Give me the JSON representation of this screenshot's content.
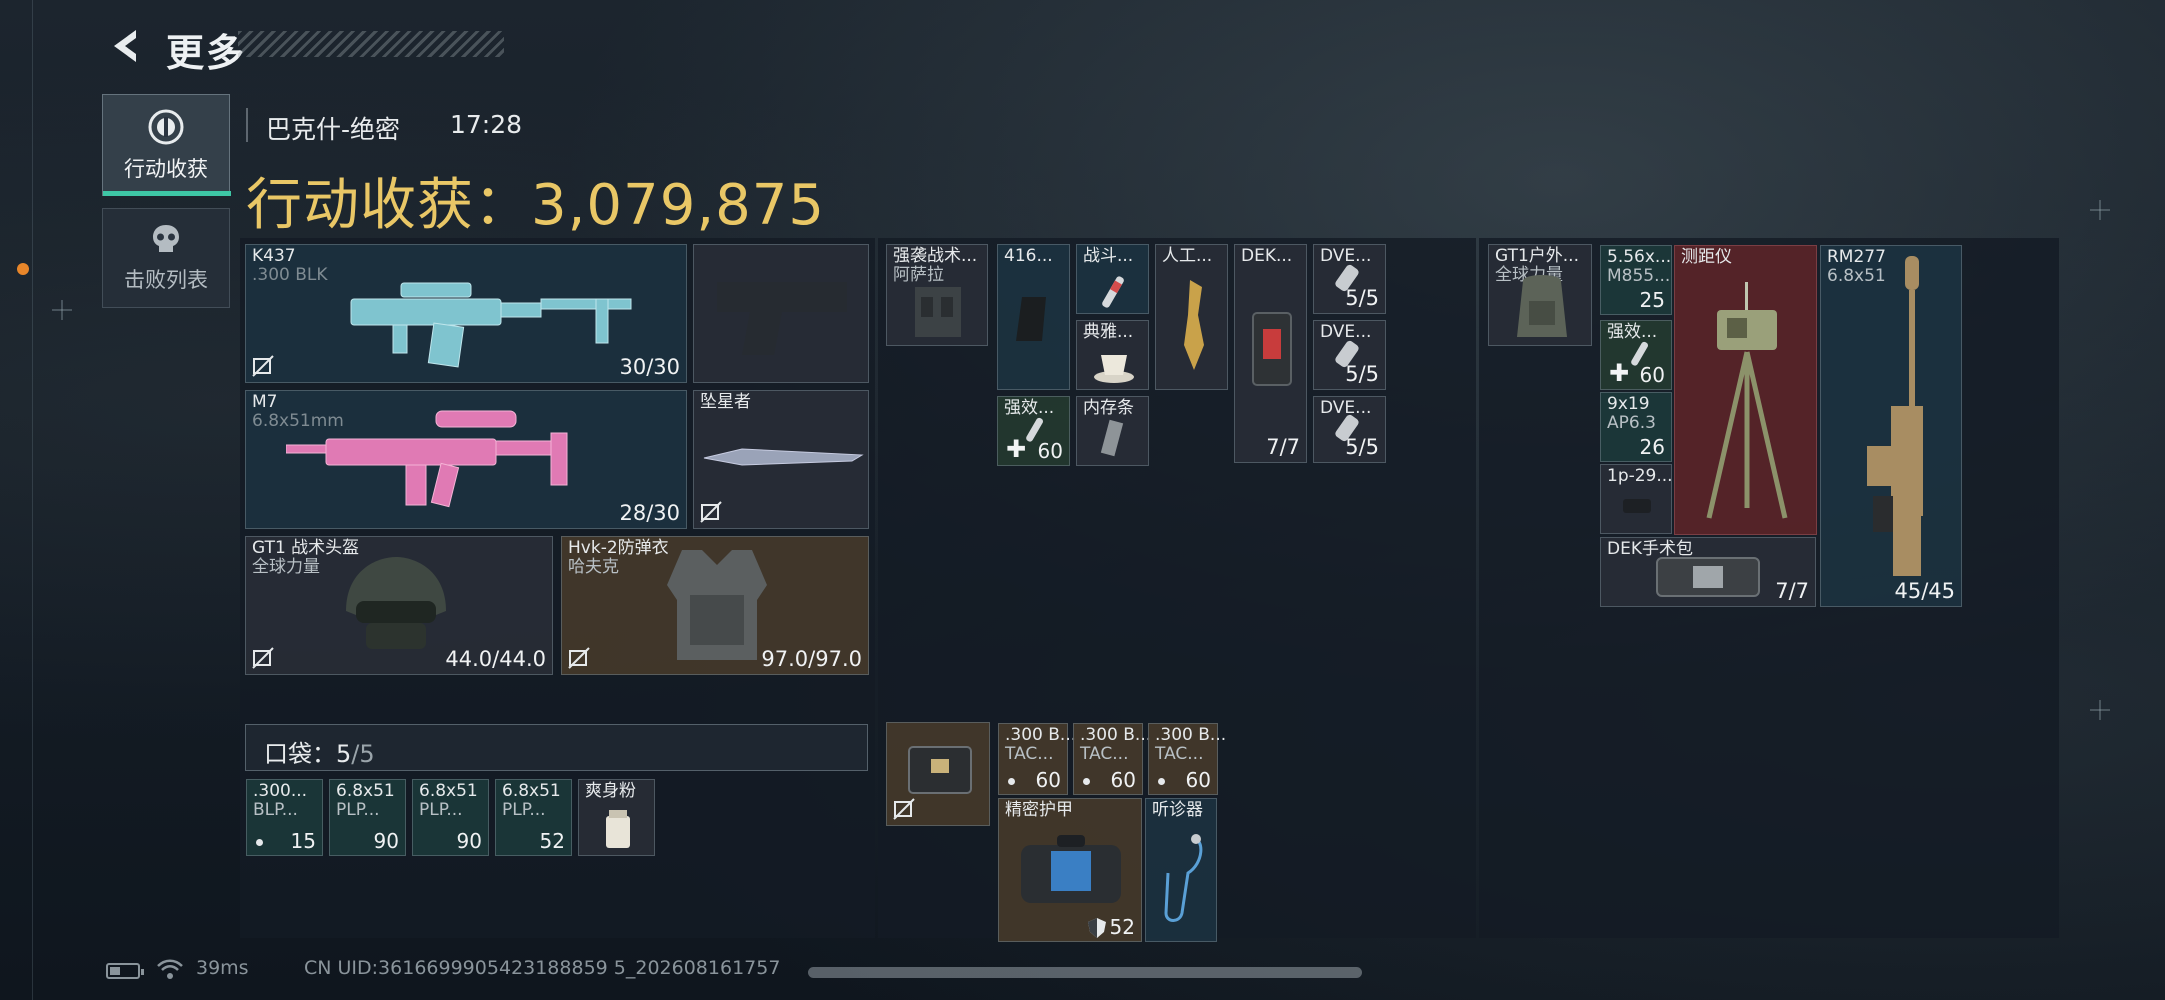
{
  "header": {
    "back_icon": "chevron-left-icon",
    "title": "更多"
  },
  "tabs": [
    {
      "label": "行动收获",
      "icon": "target-icon",
      "active": true
    },
    {
      "label": "击败列表",
      "icon": "skull-icon",
      "active": false
    }
  ],
  "mission": {
    "map": "巴克什-绝密",
    "time": "17:28",
    "haul": "行动收获：3,079,875"
  },
  "loadout": {
    "primary": {
      "name": "K437",
      "ammo_type": ".300 BLK",
      "ammo": "30/30"
    },
    "sidearm": {
      "name": "",
      "ammo": ""
    },
    "secondary": {
      "name": "M7",
      "ammo_type": "6.8x51mm",
      "ammo": "28/30"
    },
    "melee": {
      "name": "坠星者"
    },
    "helmet": {
      "name": "GT1 战术头盔",
      "brand": "全球力量",
      "durability": "44.0/44.0"
    },
    "armor": {
      "name": "Hvk-2防弹衣",
      "brand": "哈夫克",
      "durability": "97.0/97.0"
    }
  },
  "pocket": {
    "label_prefix": "口袋：",
    "used": "5",
    "slash_total": "/5",
    "items": [
      {
        "name": ".300...",
        "sub": "BLP...",
        "count": "15"
      },
      {
        "name": "6.8x51",
        "sub": "PLP...",
        "count": "90"
      },
      {
        "name": "6.8x51",
        "sub": "PLP...",
        "count": "90"
      },
      {
        "name": "6.8x51",
        "sub": "PLP...",
        "count": "52"
      },
      {
        "name": "爽身粉",
        "sub": "",
        "count": ""
      }
    ]
  },
  "rig": {
    "name": "强袭战术...",
    "brand": "阿萨拉",
    "items": [
      {
        "name": "416...",
        "count": ""
      },
      {
        "name": "战斗...",
        "count": ""
      },
      {
        "name": "人工...",
        "count": ""
      },
      {
        "name": "DEK...",
        "count": "7/7"
      },
      {
        "name": "DVE...",
        "count": "5/5"
      },
      {
        "name": "典雅...",
        "count": ""
      },
      {
        "name": "DVE...",
        "count": "5/5"
      },
      {
        "name": "强效...",
        "count": "60"
      },
      {
        "name": "内存条",
        "count": ""
      },
      {
        "name": "DVE...",
        "count": "5/5"
      }
    ]
  },
  "safebox": {
    "items": [
      {
        "name": ".300 B...",
        "sub": "TAC...",
        "count": "60"
      },
      {
        "name": ".300 B...",
        "sub": "TAC...",
        "count": "60"
      },
      {
        "name": ".300 B...",
        "sub": "TAC...",
        "count": "60"
      },
      {
        "name": "精密护甲",
        "count": "52"
      },
      {
        "name": "听诊器",
        "count": ""
      }
    ]
  },
  "backpack": {
    "name": "GT1户外...",
    "brand": "全球力量",
    "items": [
      {
        "name": "5.56x...",
        "sub": "M855...",
        "count": "25"
      },
      {
        "name": "测距仪",
        "count": ""
      },
      {
        "name": "RM277",
        "sub": "6.8x51",
        "count": "45/45"
      },
      {
        "name": "强效...",
        "count": "60"
      },
      {
        "name": "9x19",
        "sub": "AP6.3",
        "count": "26"
      },
      {
        "name": "1p-29...",
        "count": ""
      },
      {
        "name": "DEK手术包",
        "count": "7/7"
      }
    ]
  },
  "footer": {
    "ping": "39ms",
    "uid": "CN UID:3616699905423188859 5_202608161757"
  },
  "colors": {
    "accent_gold": "#e9c766",
    "tab_underline": "#3ec7a6",
    "edge_dot": "#e8862a"
  }
}
